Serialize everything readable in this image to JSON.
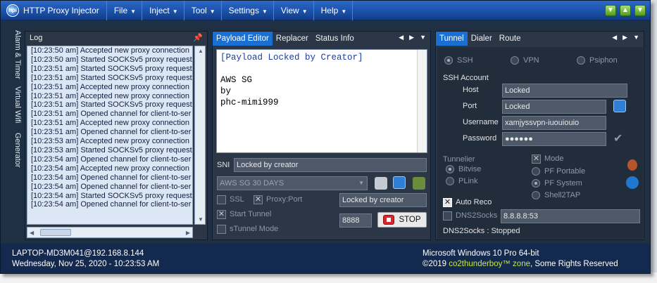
{
  "app": {
    "title": "HTTP Proxy Injector",
    "logo_text": "hpi"
  },
  "menu": [
    {
      "label": "File"
    },
    {
      "label": "Inject"
    },
    {
      "label": "Tool"
    },
    {
      "label": "Settings"
    },
    {
      "label": "View"
    },
    {
      "label": "Help"
    }
  ],
  "side_tabs": [
    "Alarm & Timer",
    "Virtual Wifi",
    "Generator"
  ],
  "log": {
    "title": "Log",
    "lines": [
      "[10:23:50 am] Accepted new proxy connection",
      "[10:23:50 am] Started SOCKSv5 proxy request",
      "[10:23:51 am] Started SOCKSv5 proxy request",
      "[10:23:51 am] Started SOCKSv5 proxy request",
      "[10:23:51 am] Accepted new proxy connection",
      "[10:23:51 am] Accepted new proxy connection",
      "[10:23:51 am] Started SOCKSv5 proxy request",
      "[10:23:51 am] Opened channel for client-to-ser",
      "[10:23:51 am] Accepted new proxy connection",
      "[10:23:51 am] Opened channel for client-to-ser",
      "[10:23:53 am] Accepted new proxy connection",
      "[10:23:53 am] Started SOCKSv5 proxy request",
      "[10:23:54 am] Opened channel for client-to-ser",
      "[10:23:54 am] Accepted new proxy connection",
      "[10:23:54 am] Opened channel for client-to-ser",
      "[10:23:54 am] Opened channel for client-to-ser",
      "[10:23:54 am] Started SOCKSv5 proxy request",
      "[10:23:54 am] Opened channel for client-to-ser"
    ]
  },
  "editor": {
    "tabs": [
      "Payload Editor",
      "Replacer",
      "Status Info"
    ],
    "content": [
      "[Payload Locked by Creator]",
      "",
      "AWS SG",
      "by",
      "phc-mimi999"
    ],
    "sni_label": "SNI",
    "sni_value": "Locked by creator",
    "profile_select": "AWS SG 30 DAYS",
    "ssl_label": "SSL",
    "proxy_label": "Proxy:Port",
    "proxy_value": "Locked by creator",
    "start_tunnel_label": "Start Tunnel",
    "stunnel_label": "sTunnel Mode",
    "port_value": "8888",
    "stop_label": "STOP"
  },
  "tunnel": {
    "tabs": [
      "Tunnel",
      "Dialer",
      "Route"
    ],
    "modes": [
      "SSH",
      "VPN",
      "Psiphon"
    ],
    "ssh_account_label": "SSH Account",
    "host_label": "Host",
    "host_value": "Locked",
    "port_label": "Port",
    "port_value": "Locked",
    "username_label": "Username",
    "username_value": "xamjyssvpn-iuouiouio",
    "password_label": "Password",
    "password_value": "●●●●●●",
    "tunnelier_label": "Tunnelier",
    "bitvise_label": "Bitvise",
    "plink_label": "PLink",
    "mode_label": "Mode",
    "pf_portable_label": "PF Portable",
    "pf_system_label": "PF System",
    "shell2tap_label": "Shell2TAP",
    "auto_reco_label": "Auto Reco",
    "dns2socks_label": "DNS2Socks",
    "dns_value": "8.8.8.8:53",
    "dns_status": "DNS2Socks : Stopped"
  },
  "status": {
    "host_info": "LAPTOP-MD3M041@192.168.8.144",
    "datetime": "Wednesday, Nov 25, 2020 - 10:23:53 AM",
    "os": "Microsoft Windows 10 Pro 64-bit",
    "copyright_prefix": "©2019",
    "brand": "co2thunderboy™ zone",
    "copyright_suffix": ", Some Rights Reserved"
  }
}
